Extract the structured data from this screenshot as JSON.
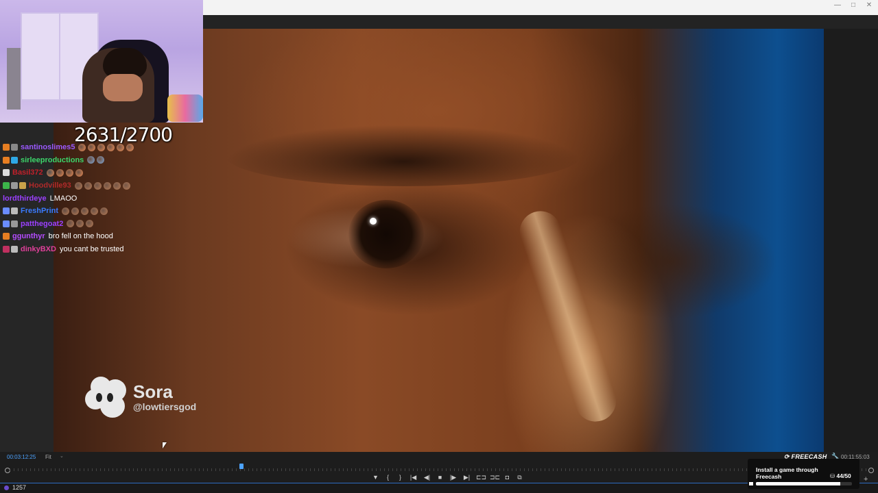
{
  "window": {
    "minimize": "—",
    "maximize": "□",
    "close": "✕"
  },
  "stream": {
    "goal_counter": "2631/2700"
  },
  "watermark": {
    "name": "Sora",
    "handle": "@lowtiersgod"
  },
  "chat": {
    "messages": [
      {
        "user": "santinoslimes5",
        "color": "#9b59ff",
        "text": "",
        "badges": [
          "#e67e22",
          "#888888"
        ],
        "emotes": 6,
        "emote_color": "#e98b55"
      },
      {
        "user": "sirleeproductions",
        "color": "#3cd66b",
        "text": "",
        "badges": [
          "#e67e22",
          "#2ea8e6"
        ],
        "emotes": 2,
        "emote_color": "#7fa7d8"
      },
      {
        "user": "Basil372",
        "color": "#c0202a",
        "text": "",
        "badges": [
          "#dddddd"
        ],
        "emotes": 4,
        "emote_color": "#e98b55"
      },
      {
        "user": "Hoodville93",
        "color": "#b02a2a",
        "text": "",
        "badges": [
          "#3cb54a",
          "#999999",
          "#c9a24a"
        ],
        "emotes": 6,
        "emote_color": "#b47a55"
      },
      {
        "user": "lordthirdeye",
        "color": "#9b40ff",
        "text": "LMAOO",
        "badges": [],
        "emotes": 0,
        "emote_color": ""
      },
      {
        "user": "FreshPrint",
        "color": "#3a7bff",
        "text": "",
        "badges": [
          "#6a8cff",
          "#bbbbbb"
        ],
        "emotes": 5,
        "emote_color": "#b47a55"
      },
      {
        "user": "patthegoat2",
        "color": "#9b40ff",
        "text": "",
        "badges": [
          "#6a8cff",
          "#999999"
        ],
        "emotes": 3,
        "emote_color": "#b47a55"
      },
      {
        "user": "ggunthyr",
        "color": "#b44cff",
        "text": "bro fell on the hood",
        "badges": [
          "#e67e22"
        ],
        "emotes": 0,
        "emote_color": ""
      },
      {
        "user": "dinkyBXD",
        "color": "#e0409a",
        "text": "you cant be trusted",
        "badges": [
          "#c03060",
          "#bbbbbb"
        ],
        "emotes": 0,
        "emote_color": ""
      }
    ]
  },
  "timeline": {
    "current_time": "00:03:12:25",
    "zoom": "Fit",
    "zoom_chevron": "⌄",
    "end_time": "00:11:55:03",
    "playhead_fraction": 0.27,
    "controls": [
      {
        "name": "add-marker",
        "glyph": "▼"
      },
      {
        "name": "mark-in",
        "glyph": "{"
      },
      {
        "name": "mark-out",
        "glyph": "}"
      },
      {
        "name": "go-to-in",
        "glyph": "|◀"
      },
      {
        "name": "step-back",
        "glyph": "◀|"
      },
      {
        "name": "stop",
        "glyph": "■"
      },
      {
        "name": "step-forward",
        "glyph": "|▶"
      },
      {
        "name": "go-to-out",
        "glyph": "▶|"
      },
      {
        "name": "insert",
        "glyph": "⊏⊐"
      },
      {
        "name": "overwrite",
        "glyph": "⊐⊏"
      },
      {
        "name": "export-frame",
        "glyph": "◘"
      },
      {
        "name": "button-editor",
        "glyph": "⧉"
      }
    ],
    "add_button": "+"
  },
  "statusbar": {
    "viewers": "1257"
  },
  "freecash": {
    "logo": "⟳ FREECASH",
    "title": "Install a game through Freecash",
    "count_icon": "⛁",
    "count": "44/50",
    "progress": 0.88
  }
}
